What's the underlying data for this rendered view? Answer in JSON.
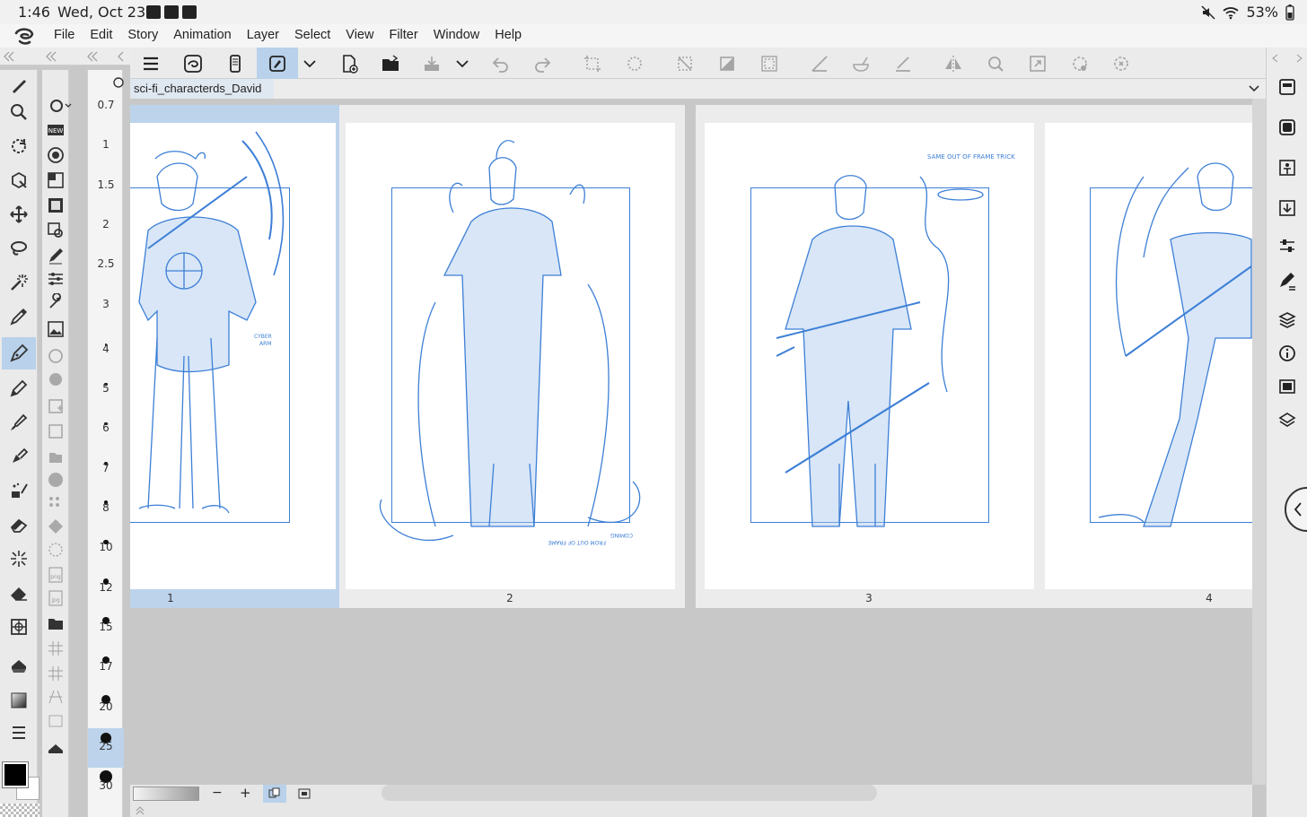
{
  "status": {
    "time": "1:46",
    "date": "Wed, Oct 23",
    "battery": "53%"
  },
  "menu": [
    "File",
    "Edit",
    "Story",
    "Animation",
    "Layer",
    "Select",
    "View",
    "Filter",
    "Window",
    "Help"
  ],
  "document_tab": {
    "title": "sci-fi_characterds_David",
    "close": "×"
  },
  "brush_sizes": [
    "0.7",
    "1",
    "1.5",
    "2",
    "2.5",
    "3",
    "4",
    "5",
    "6",
    "7",
    "8",
    "10",
    "12",
    "15",
    "17",
    "20",
    "25",
    "30"
  ],
  "selected_brush_size": "25",
  "pages": [
    {
      "number": "1",
      "selected": true
    },
    {
      "number": "2",
      "selected": false
    },
    {
      "number": "3",
      "selected": false
    },
    {
      "number": "4",
      "selected": false
    }
  ],
  "annotations": {
    "page1": "CYBER ARM",
    "page3": "SAME OUT OF FRAME TRICK"
  },
  "bottom": {
    "zoom_out": "−",
    "zoom_in": "+"
  },
  "colors": {
    "accent": "#b9d1ea",
    "sketch": "#3d7fd6",
    "foreground": "#000000",
    "background": "#ffffff"
  }
}
